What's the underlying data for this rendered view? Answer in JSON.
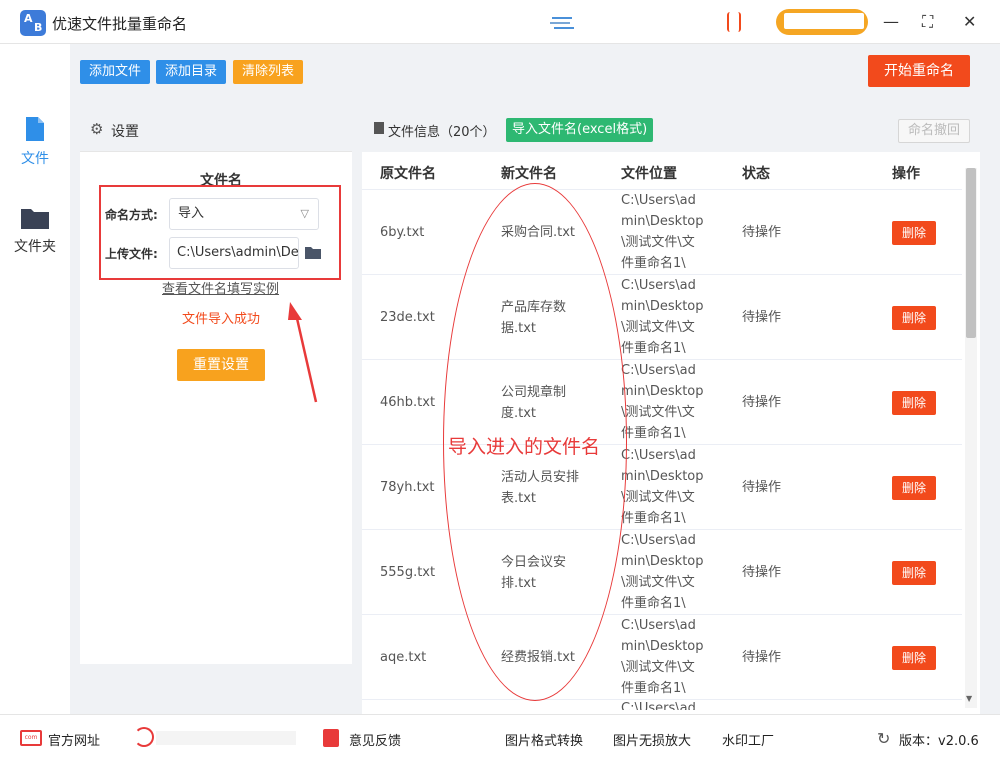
{
  "app": {
    "title": "优速文件批量重命名",
    "logo_text_a": "A",
    "logo_text_b": "B"
  },
  "window_controls": {
    "minimize": "—",
    "maximize": "⛶",
    "close": "✕"
  },
  "toolbar": {
    "add_files": "添加文件",
    "add_folder": "添加目录",
    "clear_list": "清除列表",
    "start_rename": "开始重命名"
  },
  "sidebar": {
    "items": [
      {
        "label": "文件",
        "icon": "file-icon",
        "active": true
      },
      {
        "label": "文件夹",
        "icon": "folder-icon",
        "active": false
      }
    ]
  },
  "settings": {
    "header": "设置",
    "section_title": "文件名",
    "naming_mode_label": "命名方式:",
    "naming_mode_value": "导入",
    "upload_label": "上传文件:",
    "upload_value": "C:\\Users\\admin\\De",
    "example_link": "查看文件名填写实例",
    "status_message": "文件导入成功",
    "reset_button": "重置设置"
  },
  "file_panel": {
    "title": "文件信息（20个）",
    "import_button": "导入文件名(excel格式)",
    "undo_button": "命名撤回",
    "columns": [
      "原文件名",
      "新文件名",
      "文件位置",
      "状态",
      "操作"
    ],
    "rows": [
      {
        "original": "6by.txt",
        "new_lines": [
          "采购合同.txt"
        ],
        "path_lines": [
          "C:\\Users\\ad",
          "min\\Desktop",
          "\\测试文件\\文",
          "件重命名1\\"
        ],
        "status": "待操作",
        "action": "删除"
      },
      {
        "original": "23de.txt",
        "new_lines": [
          "产品库存数",
          "据.txt"
        ],
        "path_lines": [
          "C:\\Users\\ad",
          "min\\Desktop",
          "\\测试文件\\文",
          "件重命名1\\"
        ],
        "status": "待操作",
        "action": "删除"
      },
      {
        "original": "46hb.txt",
        "new_lines": [
          "公司规章制",
          "度.txt"
        ],
        "path_lines": [
          "C:\\Users\\ad",
          "min\\Desktop",
          "\\测试文件\\文",
          "件重命名1\\"
        ],
        "status": "待操作",
        "action": "删除"
      },
      {
        "original": "78yh.txt",
        "new_lines": [
          "活动人员安排",
          "表.txt"
        ],
        "path_lines": [
          "C:\\Users\\ad",
          "min\\Desktop",
          "\\测试文件\\文",
          "件重命名1\\"
        ],
        "status": "待操作",
        "action": "删除"
      },
      {
        "original": "555g.txt",
        "new_lines": [
          "今日会议安",
          "排.txt"
        ],
        "path_lines": [
          "C:\\Users\\ad",
          "min\\Desktop",
          "\\测试文件\\文",
          "件重命名1\\"
        ],
        "status": "待操作",
        "action": "删除"
      },
      {
        "original": "aqe.txt",
        "new_lines": [
          "经费报销.txt"
        ],
        "path_lines": [
          "C:\\Users\\ad",
          "min\\Desktop",
          "\\测试文件\\文",
          "件重命名1\\"
        ],
        "status": "待操作",
        "action": "删除"
      }
    ],
    "partial_row_text": "C:\\Users\\ad"
  },
  "annotation": {
    "text": "导入进入的文件名"
  },
  "footer": {
    "website": "官方网址",
    "feedback": "意见反馈",
    "image_convert": "图片格式转换",
    "image_enlarge": "图片无损放大",
    "watermark": "水印工厂",
    "version": "版本：v2.0.6"
  },
  "colors": {
    "primary_blue": "#2f8fe8",
    "orange": "#f8a21e",
    "red": "#f24a1c",
    "green": "#2eb872",
    "annotation_red": "#e83a3a"
  }
}
